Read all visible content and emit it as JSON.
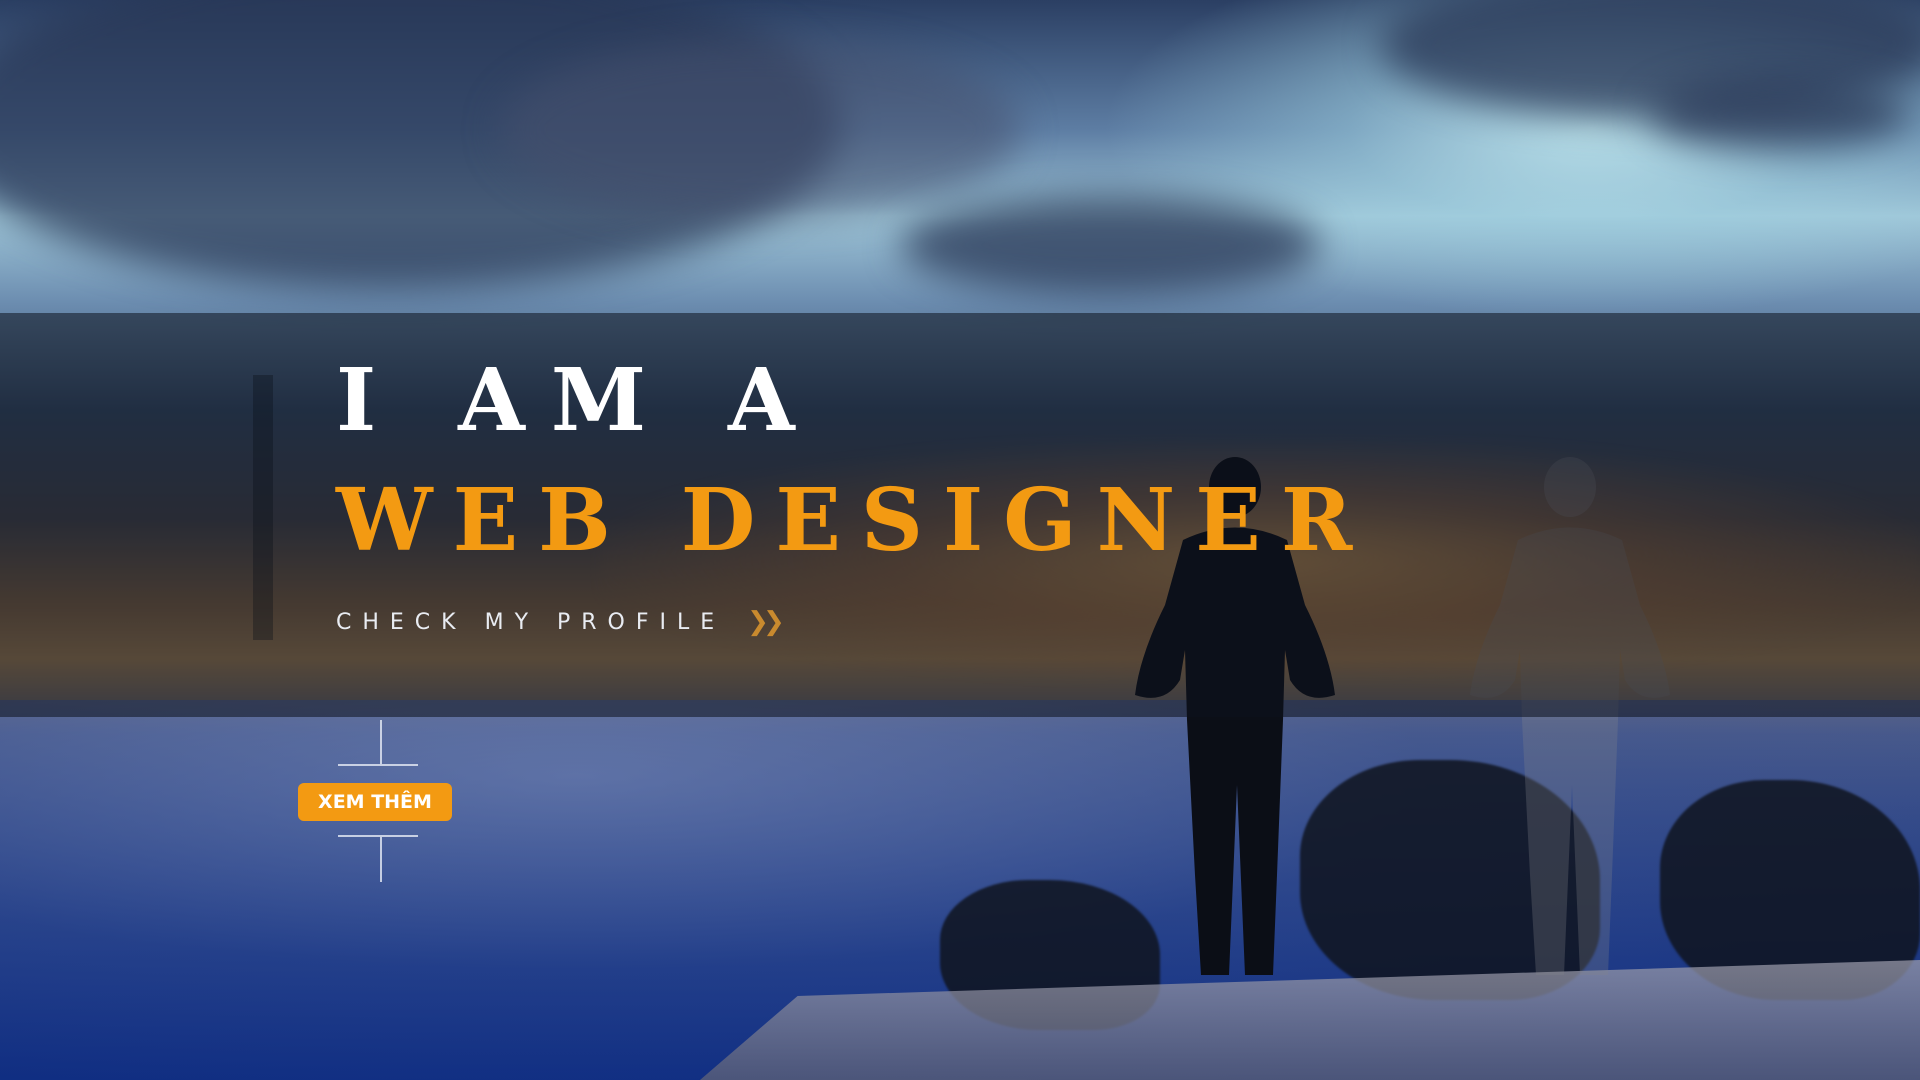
{
  "hero": {
    "title_line1": "I AM A",
    "title_line2": "WEB DESIGNER",
    "profile_link": "CHECK MY PROFILE",
    "profile_icon": "double-chevron-right-icon",
    "cta_label": "XEM THÊM"
  },
  "colors": {
    "accent": "#f39a12",
    "heading": "#ffffff",
    "band": "rgba(12,18,30,0.55)"
  }
}
